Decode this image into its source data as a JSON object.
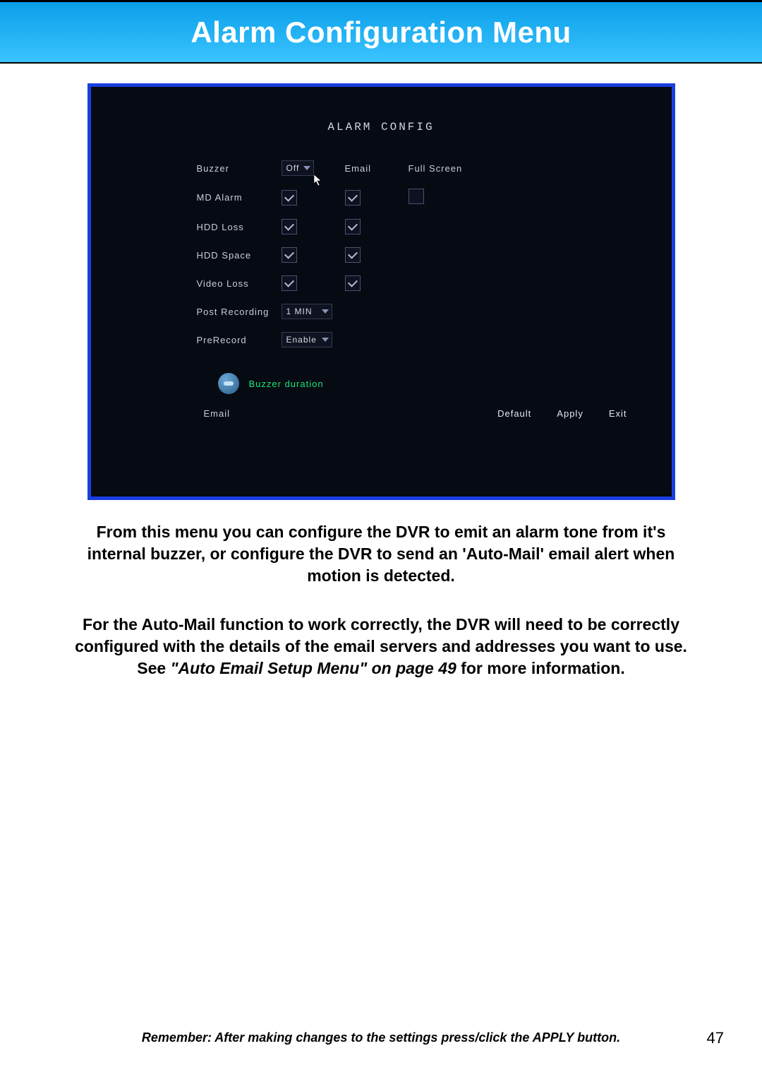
{
  "header": {
    "title": "Alarm Configuration Menu"
  },
  "dvr": {
    "title": "ALARM CONFIG",
    "columns": {
      "buzzer": "Buzzer",
      "email": "Email",
      "fullscreen": "Full Screen"
    },
    "buzzer_value": "Off",
    "rows": {
      "md_alarm": {
        "label": "MD Alarm",
        "buzzer": true,
        "email": true,
        "fullscreen": false
      },
      "hdd_loss": {
        "label": "HDD Loss",
        "buzzer": true,
        "email": true
      },
      "hdd_space": {
        "label": "HDD Space",
        "buzzer": true,
        "email": true
      },
      "video_loss": {
        "label": "Video Loss",
        "buzzer": true,
        "email": true
      }
    },
    "post_recording": {
      "label": "Post Recording",
      "value": "1 MIN"
    },
    "prerecord": {
      "label": "PreRecord",
      "value": "Enable"
    },
    "buzzer_duration_label": "Buzzer duration",
    "email_link": "Email",
    "buttons": {
      "default": "Default",
      "apply": "Apply",
      "exit": "Exit"
    }
  },
  "paragraphs": {
    "p1": "From this menu you can configure the DVR to emit an alarm tone from it's internal buzzer, or configure the DVR to send an 'Auto-Mail' email alert when motion is detected.",
    "p2a": "For the Auto-Mail function to work correctly, the DVR will need to be correctly configured with the details of the email servers and addresses you want to use. See ",
    "p2b": "\"Auto Email Setup Menu\" on page 49",
    "p2c": " for more information."
  },
  "footer": {
    "reminder": "Remember: After making changes to the settings press/click the APPLY button.",
    "page": "47"
  }
}
